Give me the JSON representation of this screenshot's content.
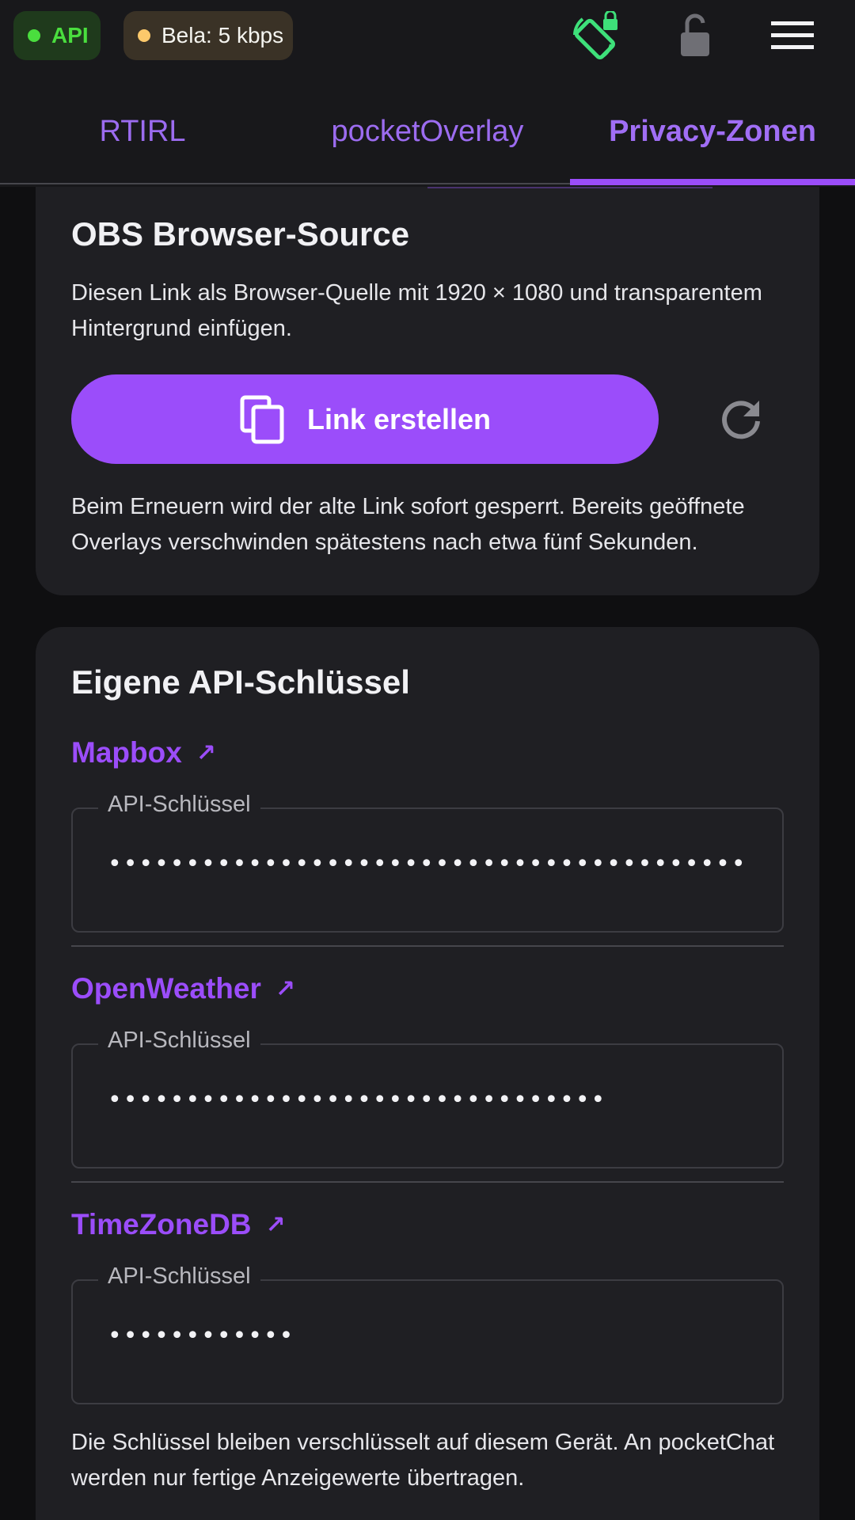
{
  "status": {
    "api_label": "API",
    "bela_label": "Bela: 5 kbps",
    "api_color": "#4ade3e",
    "bela_color": "#fcc96b"
  },
  "toolbar": {
    "rotation_lock_icon": "screen-rotation-lock-icon",
    "lock_icon": "lock-open-icon",
    "menu_icon": "hamburger-menu-icon"
  },
  "tabs": [
    {
      "label": "RTIRL",
      "active": false
    },
    {
      "label": "pocketOverlay",
      "active": false
    },
    {
      "label": "Privacy-Zonen",
      "active": true
    }
  ],
  "obs": {
    "title": "OBS Browser-Source",
    "description": "Diesen Link als Browser-Quelle mit 1920 × 1080 und transparentem Hintergrund einfügen.",
    "create_button": "Link erstellen",
    "note": "Beim Erneuern wird der alte Link sofort gesperrt. Bereits geöffnete Overlays verschwinden spätestens nach etwa fünf Sekunden."
  },
  "api_keys": {
    "title": "Eigene API-Schlüssel",
    "services": [
      {
        "name": "Mapbox",
        "field_label": "API-Schlüssel",
        "value": "••••••••••••••••••••••••••••••••••••••••••••••••••••••••••••••••••••••"
      },
      {
        "name": "OpenWeather",
        "field_label": "API-Schlüssel",
        "value": "••••••••••••••••••••••••••••••••"
      },
      {
        "name": "TimeZoneDB",
        "field_label": "API-Schlüssel",
        "value": "••••••••••••"
      }
    ],
    "link_arrow": "↗",
    "note": "Die Schlüssel bleiben verschlüsselt auf diesem Gerät. An pocketChat werden nur fertige Anzeigewerte übertragen."
  },
  "colors": {
    "accent": "#9b4dfa",
    "background": "#0f0f11",
    "card": "#1f1f23"
  }
}
